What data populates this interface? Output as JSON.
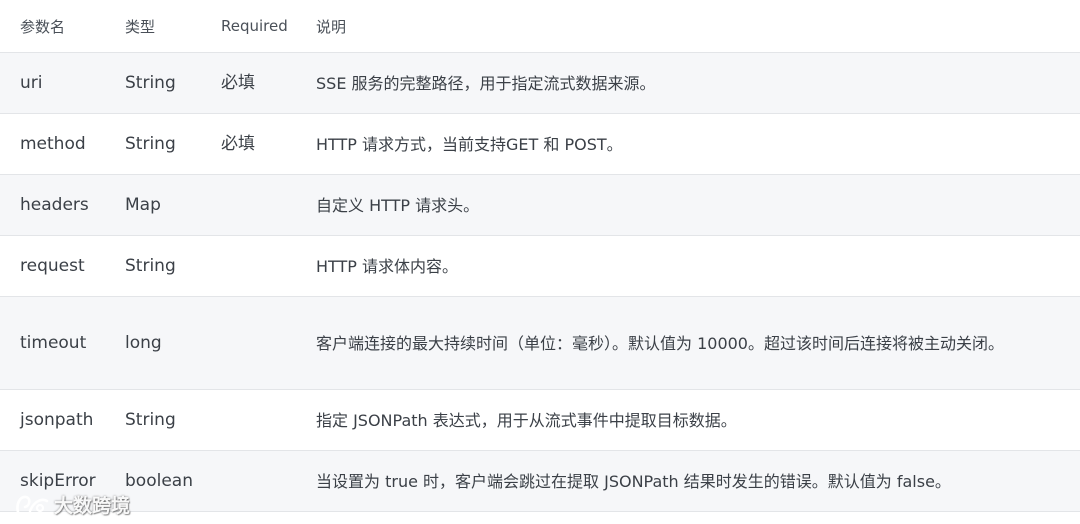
{
  "table": {
    "headers": [
      "参数名",
      "类型",
      "Required",
      "说明"
    ],
    "rows": [
      {
        "name": "uri",
        "type": "String",
        "required": "必填",
        "desc": "SSE 服务的完整路径，用于指定流式数据来源。"
      },
      {
        "name": "method",
        "type": "String",
        "required": "必填",
        "desc": "HTTP 请求方式，当前支持GET 和 POST。"
      },
      {
        "name": "headers",
        "type": "Map",
        "required": "",
        "desc": "自定义 HTTP 请求头。"
      },
      {
        "name": "request",
        "type": "String",
        "required": "",
        "desc": "HTTP 请求体内容。"
      },
      {
        "name": "timeout",
        "type": "long",
        "required": "",
        "desc": "客户端连接的最大持续时间（单位：毫秒）。默认值为 10000。超过该时间后连接将被主动关闭。"
      },
      {
        "name": "jsonpath",
        "type": "String",
        "required": "",
        "desc": "指定 JSONPath 表达式，用于从流式事件中提取目标数据。"
      },
      {
        "name": "skipError",
        "type": "boolean",
        "required": "",
        "desc": "当设置为 true 时，客户端会跳过在提取 JSONPath 结果时发生的错误。默认值为 false。"
      }
    ]
  },
  "watermark": {
    "text": "大数跨境"
  }
}
